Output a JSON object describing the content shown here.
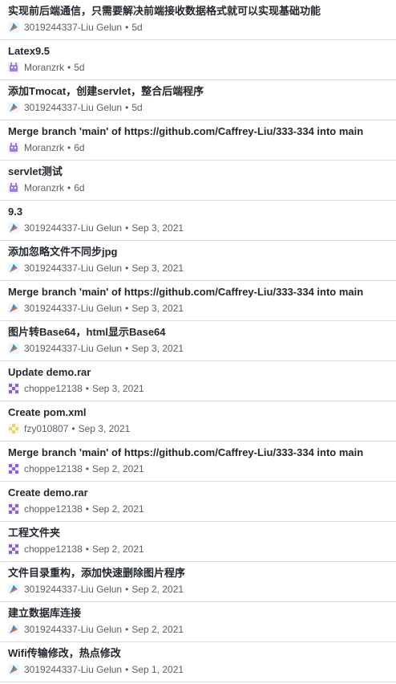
{
  "commits": [
    {
      "title": "实现前后端通信，只需要解决前端接收数据格式就可以实现基础功能",
      "author": "3019244337-Liu Gelun",
      "date": "5d",
      "avatar": "kite-avatar-icon"
    },
    {
      "title": "Latex9.5",
      "author": "Moranzrk",
      "date": "5d",
      "avatar": "robot-avatar-icon"
    },
    {
      "title": "添加Tmocat，创建servlet，整合后端程序",
      "author": "3019244337-Liu Gelun",
      "date": "5d",
      "avatar": "kite-avatar-icon"
    },
    {
      "title": "Merge branch 'main' of https://github.com/Caffrey-Liu/333-334 into main",
      "author": "Moranzrk",
      "date": "6d",
      "avatar": "robot-avatar-icon"
    },
    {
      "title": "servlet测试",
      "author": "Moranzrk",
      "date": "6d",
      "avatar": "robot-avatar-icon"
    },
    {
      "title": "9.3",
      "author": "3019244337-Liu Gelun",
      "date": "Sep 3, 2021",
      "avatar": "kite-avatar-icon"
    },
    {
      "title": "添加忽略文件不同步jpg",
      "author": "3019244337-Liu Gelun",
      "date": "Sep 3, 2021",
      "avatar": "kite-avatar-icon"
    },
    {
      "title": "Merge branch 'main' of https://github.com/Caffrey-Liu/333-334 into main",
      "author": "3019244337-Liu Gelun",
      "date": "Sep 3, 2021",
      "avatar": "kite-avatar-icon"
    },
    {
      "title": "图片转Base64，html显示Base64",
      "author": "3019244337-Liu Gelun",
      "date": "Sep 3, 2021",
      "avatar": "kite-avatar-icon"
    },
    {
      "title": "Update demo.rar",
      "author": "choppe12138",
      "date": "Sep 3, 2021",
      "avatar": "identicon-purple-avatar-icon"
    },
    {
      "title": "Create pom.xml",
      "author": "fzy010807",
      "date": "Sep 3, 2021",
      "avatar": "identicon-yellow-avatar-icon"
    },
    {
      "title": "Merge branch 'main' of https://github.com/Caffrey-Liu/333-334 into main",
      "author": "choppe12138",
      "date": "Sep 2, 2021",
      "avatar": "identicon-purple-avatar-icon"
    },
    {
      "title": "Create demo.rar",
      "author": "choppe12138",
      "date": "Sep 2, 2021",
      "avatar": "identicon-purple-avatar-icon"
    },
    {
      "title": "工程文件夹",
      "author": "choppe12138",
      "date": "Sep 2, 2021",
      "avatar": "identicon-purple-avatar-icon"
    },
    {
      "title": "文件目录重构，添加快速删除图片程序",
      "author": "3019244337-Liu Gelun",
      "date": "Sep 2, 2021",
      "avatar": "kite-avatar-icon"
    },
    {
      "title": "建立数据库连接",
      "author": "3019244337-Liu Gelun",
      "date": "Sep 2, 2021",
      "avatar": "kite-avatar-icon"
    },
    {
      "title": "Wifi传输修改，热点修改",
      "author": "3019244337-Liu Gelun",
      "date": "Sep 1, 2021",
      "avatar": "kite-avatar-icon"
    }
  ],
  "meta_separator": "•",
  "colors": {
    "title": "#24292f",
    "meta": "#57606a",
    "border": "#d8dee4",
    "avatar_purple": "#8a63d2",
    "avatar_yellow": "#e6d27a",
    "avatar_robot": "#9d7fe0",
    "avatar_kite": "#4a9fd8"
  }
}
